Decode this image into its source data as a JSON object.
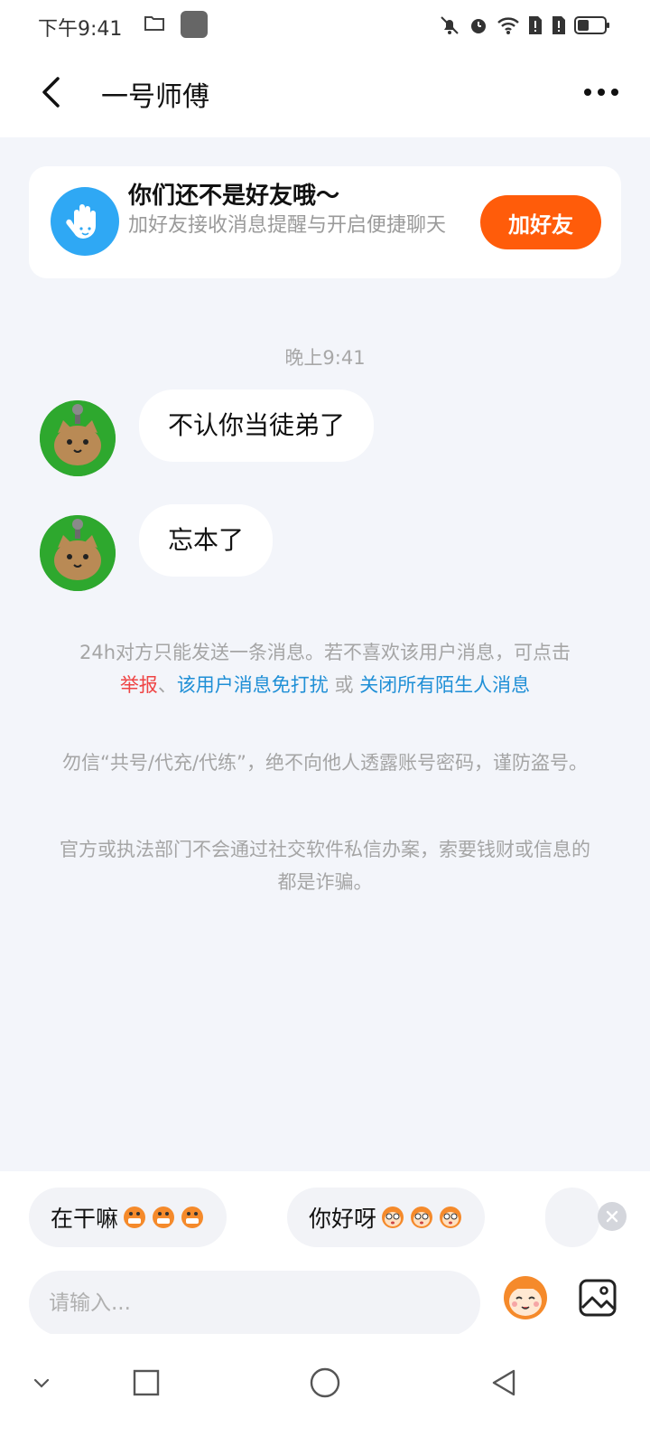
{
  "status_bar": {
    "time": "下午9:41"
  },
  "header": {
    "title": "一号师傅",
    "back_icon": "chevron-left-icon",
    "more_icon": "more-dots-icon"
  },
  "friend_card": {
    "title": "你们还不是好友哦～",
    "subtitle": "加好友接收消息提醒与开启便捷聊天",
    "button_label": "加好友",
    "accent_color": "#ff5c0a",
    "icon": "wave-hand-icon"
  },
  "chat": {
    "timestamp": "晚上9:41",
    "messages": [
      {
        "text": "不认你当徒弟了"
      },
      {
        "text": "忘本了"
      }
    ]
  },
  "notices": {
    "limit_text": "24h对方只能发送一条消息。若不喜欢该用户消息，可点击",
    "report_link": "举报",
    "separator": "、",
    "mute_link": "该用户消息免打扰",
    "or_text": "或",
    "close_all_link": "关闭所有陌生人消息",
    "warning_1": "勿信“共号/代充/代练”，绝不向他人透露账号密码，谨防盗号。",
    "warning_2": "官方或执法部门不会通过社交软件私信办案，索要钱财或信息的都是诈骗。"
  },
  "quick_replies": [
    {
      "text": "在干嘛"
    },
    {
      "text": "你好呀"
    }
  ],
  "input": {
    "placeholder": "请输入..."
  },
  "colors": {
    "link_blue": "#1f8fd6",
    "link_red": "#ef4444"
  }
}
